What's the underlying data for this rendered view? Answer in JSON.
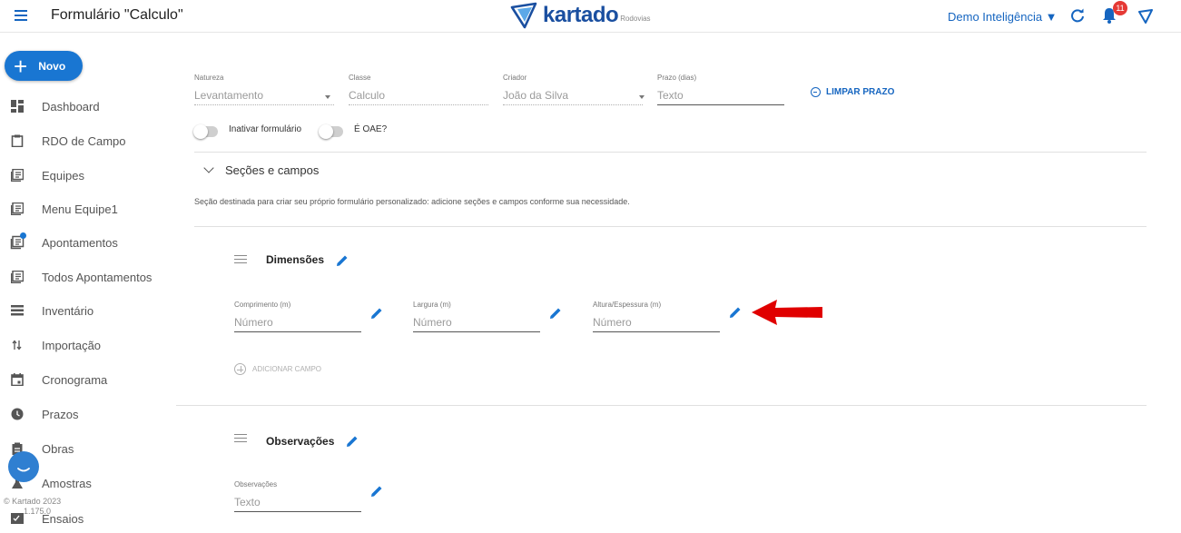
{
  "header": {
    "title": "Formulário \"Calculo\"",
    "logo_text": "kartado",
    "logo_sub": "Rodovias",
    "org_label": "Demo Inteligência ▼",
    "notification_count": "11"
  },
  "sidebar": {
    "new_label": "Novo",
    "items": [
      {
        "label": "Dashboard",
        "icon": "dashboard-icon"
      },
      {
        "label": "RDO de Campo",
        "icon": "clipboard-icon"
      },
      {
        "label": "Equipes",
        "icon": "list-icon"
      },
      {
        "label": "Menu Equipe1",
        "icon": "list-icon"
      },
      {
        "label": "Apontamentos",
        "icon": "list-badge-icon"
      },
      {
        "label": "Todos Apontamentos",
        "icon": "list-icon"
      },
      {
        "label": "Inventário",
        "icon": "lines-icon"
      },
      {
        "label": "Importação",
        "icon": "import-icon"
      },
      {
        "label": "Cronograma",
        "icon": "calendar-icon"
      },
      {
        "label": "Prazos",
        "icon": "clock-icon"
      },
      {
        "label": "Obras",
        "icon": "clipboard-icon"
      },
      {
        "label": "Amostras",
        "icon": "sample-icon"
      },
      {
        "label": "Ensaios",
        "icon": "test-icon"
      }
    ],
    "copyright": "© Kartado 2023",
    "version": "1.175.0"
  },
  "form": {
    "fields": [
      {
        "label": "Natureza",
        "value": "Levantamento"
      },
      {
        "label": "Classe",
        "value": "Calculo"
      },
      {
        "label": "Criador",
        "value": "João da Silva"
      },
      {
        "label": "Prazo (dias)",
        "placeholder": "Texto"
      }
    ],
    "clear_deadline": "LIMPAR PRAZO",
    "toggles": [
      {
        "label": "Inativar formulário"
      },
      {
        "label": "É OAE?"
      }
    ]
  },
  "sections_panel": {
    "title": "Seções e campos",
    "description": "Seção destinada para criar seu próprio formulário personalizado: adicione seções e campos conforme sua necessidade.",
    "sections": [
      {
        "title": "Dimensões",
        "fields": [
          {
            "label": "Comprimento (m)",
            "placeholder": "Número"
          },
          {
            "label": "Largura (m)",
            "placeholder": "Número"
          },
          {
            "label": "Altura/Espessura (m)",
            "placeholder": "Número"
          }
        ],
        "add_field": "ADICIONAR CAMPO"
      },
      {
        "title": "Observações",
        "fields": [
          {
            "label": "Observações",
            "placeholder": "Texto"
          }
        ]
      }
    ]
  },
  "colors": {
    "accent": "#1976d2",
    "annotation_arrow": "#e00000",
    "badge": "#e53935"
  }
}
